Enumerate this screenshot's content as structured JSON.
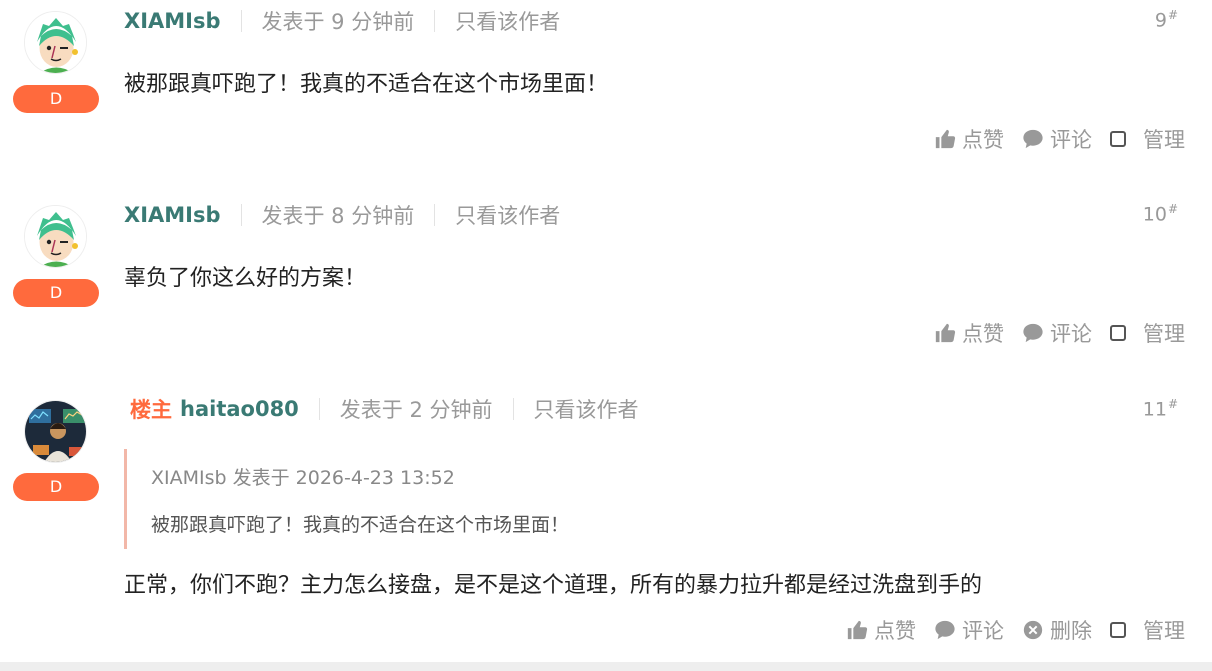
{
  "posts": [
    {
      "owner_label": "",
      "username": "XIAMIsb",
      "time": "发表于 9 分钟前",
      "only_author": "只看该作者",
      "floor": "9",
      "floor_mark": "#",
      "badge": "D",
      "content": "被那跟真吓跑了！我真的不适合在这个市场里面！",
      "actions": {
        "like": "点赞",
        "comment": "评论",
        "manage": "管理"
      }
    },
    {
      "owner_label": "",
      "username": "XIAMIsb",
      "time": "发表于 8 分钟前",
      "only_author": "只看该作者",
      "floor": "10",
      "floor_mark": "#",
      "badge": "D",
      "content": "辜负了你这么好的方案！",
      "actions": {
        "like": "点赞",
        "comment": "评论",
        "manage": "管理"
      }
    },
    {
      "owner_label": "楼主",
      "username": "haitao080",
      "time": "发表于 2 分钟前",
      "only_author": "只看该作者",
      "floor": "11",
      "floor_mark": "#",
      "badge": "D",
      "quote": {
        "header": "XIAMIsb 发表于 2026-4-23 13:52",
        "body": "被那跟真吓跑了！我真的不适合在这个市场里面！"
      },
      "content": "正常，你们不跑？主力怎么接盘，是不是这个道理，所有的暴力拉升都是经过洗盘到手的",
      "actions": {
        "like": "点赞",
        "comment": "评论",
        "delete": "删除",
        "manage": "管理"
      }
    }
  ],
  "colors": {
    "username": "#3a7a74",
    "owner": "#ff6a3d",
    "badge": "#ff6a3d",
    "muted": "#999999",
    "quote_border": "#f2b7a8"
  }
}
